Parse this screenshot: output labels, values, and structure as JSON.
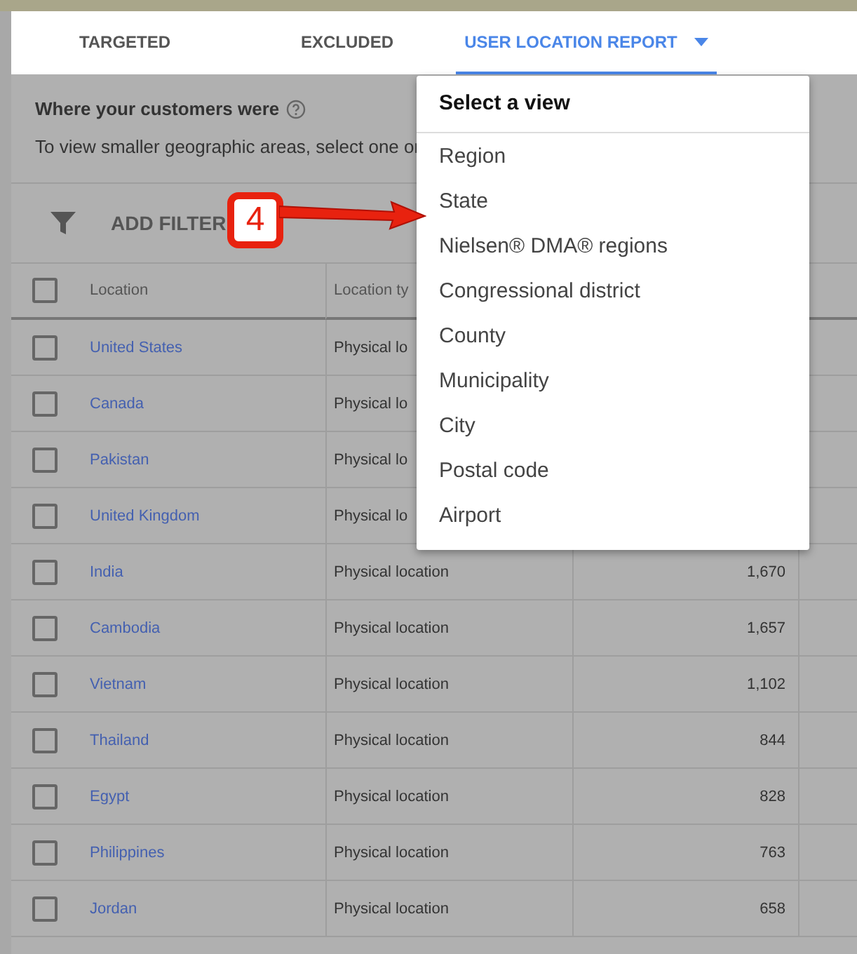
{
  "tabs": [
    {
      "label": "TARGETED",
      "selected": false,
      "dropdown": false
    },
    {
      "label": "EXCLUDED",
      "selected": false,
      "dropdown": false
    },
    {
      "label": "USER LOCATION REPORT",
      "selected": true,
      "dropdown": true
    }
  ],
  "section": {
    "title": "Where your customers were",
    "subtitle": "To view smaller geographic areas, select one or"
  },
  "filter_bar": {
    "label": "ADD FILTER"
  },
  "table": {
    "header_checked": false,
    "columns": [
      "Location",
      "Location ty"
    ],
    "rows": [
      {
        "checked": false,
        "location": "United States",
        "type": "Physical lo"
      },
      {
        "checked": false,
        "location": "Canada",
        "type": "Physical lo"
      },
      {
        "checked": false,
        "location": "Pakistan",
        "type": "Physical lo"
      },
      {
        "checked": false,
        "location": "United Kingdom",
        "type": "Physical lo"
      },
      {
        "checked": false,
        "location": "India",
        "type": "Physical location",
        "value": "1,670"
      },
      {
        "checked": false,
        "location": "Cambodia",
        "type": "Physical location",
        "value": "1,657"
      },
      {
        "checked": false,
        "location": "Vietnam",
        "type": "Physical location",
        "value": "1,102"
      },
      {
        "checked": false,
        "location": "Thailand",
        "type": "Physical location",
        "value": "844"
      },
      {
        "checked": false,
        "location": "Egypt",
        "type": "Physical location",
        "value": "828"
      },
      {
        "checked": false,
        "location": "Philippines",
        "type": "Physical location",
        "value": "763"
      },
      {
        "checked": false,
        "location": "Jordan",
        "type": "Physical location",
        "value": "658"
      }
    ]
  },
  "menu": {
    "title": "Select a view",
    "items": [
      "Region",
      "State",
      "Nielsen® DMA® regions",
      "Congressional district",
      "County",
      "Municipality",
      "City",
      "Postal code",
      "Airport"
    ]
  },
  "callout": {
    "label": "4"
  }
}
